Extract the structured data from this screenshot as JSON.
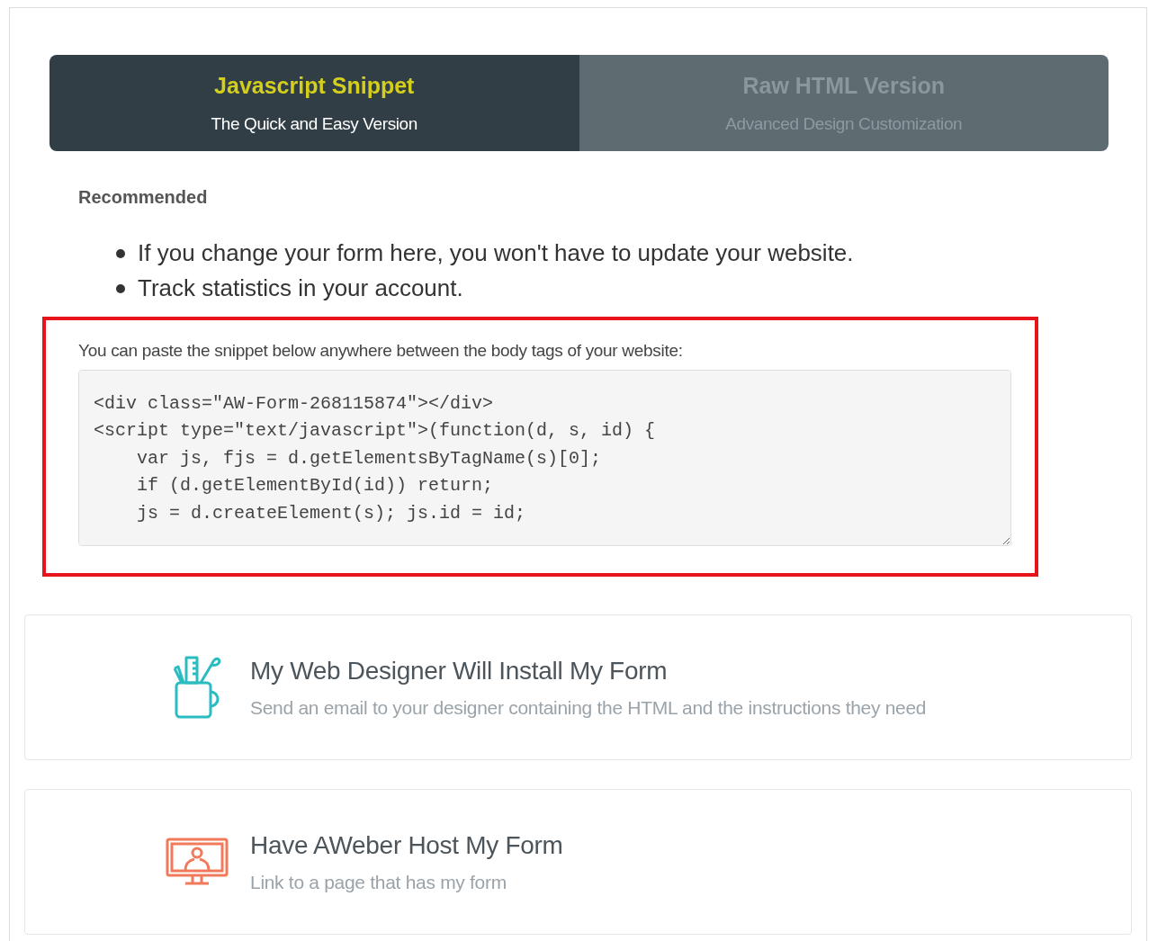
{
  "tabs": [
    {
      "title": "Javascript Snippet",
      "subtitle": "The Quick and Easy Version",
      "selected": true
    },
    {
      "title": "Raw HTML Version",
      "subtitle": "Advanced Design Customization",
      "selected": false
    }
  ],
  "recommended_label": "Recommended",
  "benefits": [
    "If you change your form here, you won't have to update your website.",
    "Track statistics in your account."
  ],
  "snippet": {
    "label": "You can paste the snippet below anywhere between the body tags of your website:",
    "code": "<div class=\"AW-Form-268115874\"></div>\n<script type=\"text/javascript\">(function(d, s, id) {\n    var js, fjs = d.getElementsByTagName(s)[0];\n    if (d.getElementById(id)) return;\n    js = d.createElement(s); js.id = id;"
  },
  "options": [
    {
      "kind": "designer",
      "title": "My Web Designer Will Install My Form",
      "description": "Send an email to your designer containing the HTML and the instructions they need"
    },
    {
      "kind": "hosted",
      "title": "Have AWeber Host My Form",
      "description": "Link to a page that has my form"
    }
  ]
}
